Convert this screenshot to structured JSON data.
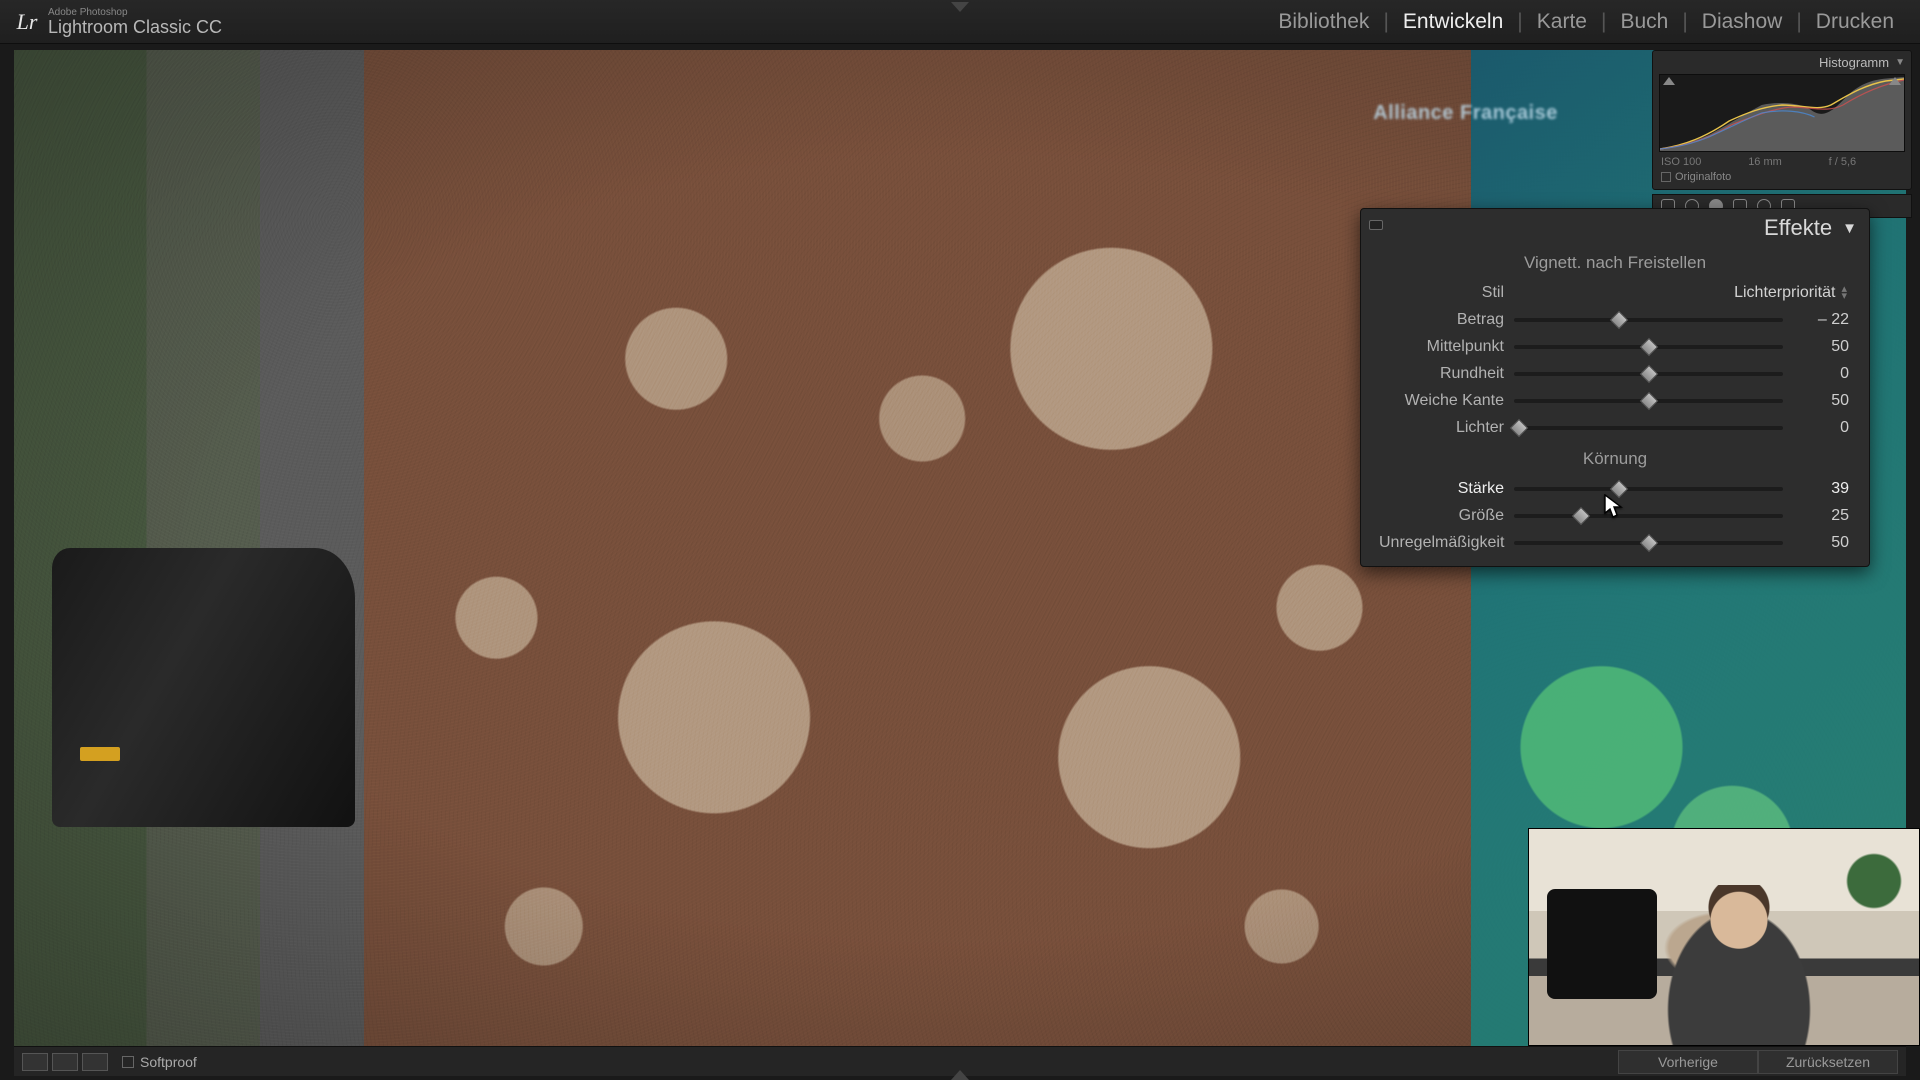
{
  "app": {
    "vendor": "Adobe Photoshop",
    "name": "Lightroom Classic CC",
    "logo": "Lr"
  },
  "modules": {
    "items": [
      "Bibliothek",
      "Entwickeln",
      "Karte",
      "Buch",
      "Diashow",
      "Drucken"
    ],
    "active_index": 1
  },
  "mural_text": "Alliance Française",
  "histogram": {
    "title": "Histogramm",
    "info": {
      "iso": "ISO 100",
      "focal": "16 mm",
      "aperture": "f / 5,6",
      "shutter": ""
    },
    "original_label": "Originalfoto"
  },
  "effects": {
    "panel_title": "Effekte",
    "vignette": {
      "section_title": "Vignett. nach Freistellen",
      "style_label": "Stil",
      "style_value": "Lichterpriorität",
      "sliders": {
        "betrag": {
          "label": "Betrag",
          "value": "– 22",
          "pos": 39,
          "range": "-100..100"
        },
        "mittelpunkt": {
          "label": "Mittelpunkt",
          "value": "50",
          "pos": 50,
          "range": "0..100"
        },
        "rundheit": {
          "label": "Rundheit",
          "value": "0",
          "pos": 50,
          "range": "-100..100"
        },
        "weiche": {
          "label": "Weiche Kante",
          "value": "50",
          "pos": 50,
          "range": "0..100"
        },
        "lichter": {
          "label": "Lichter",
          "value": "0",
          "pos": 2,
          "range": "0..100"
        }
      }
    },
    "grain": {
      "section_title": "Körnung",
      "sliders": {
        "staerke": {
          "label": "Stärke",
          "value": "39",
          "pos": 39,
          "range": "0..100",
          "active": true
        },
        "groesse": {
          "label": "Größe",
          "value": "25",
          "pos": 25,
          "range": "0..100"
        },
        "unregel": {
          "label": "Unregelmäßigkeit",
          "value": "50",
          "pos": 50,
          "range": "0..100"
        }
      }
    }
  },
  "bottombar": {
    "softproof": "Softproof",
    "prev": "Vorherige",
    "reset": "Zurücksetzen"
  }
}
